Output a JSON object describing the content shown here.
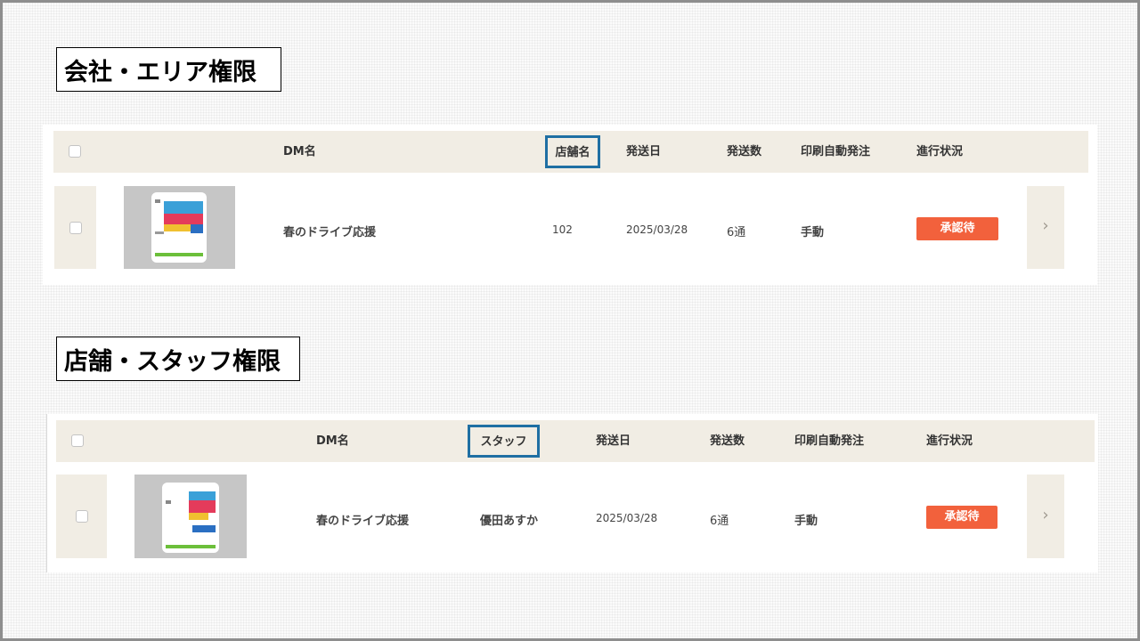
{
  "sections": [
    {
      "title": "会社・エリア権限",
      "headers": {
        "dm_name": "DM名",
        "store_name": "店舗名",
        "send_date": "発送日",
        "send_count": "発送数",
        "print_auto_order": "印刷自動発注",
        "progress": "進行状況"
      },
      "row": {
        "dm_name": "春のドライブ応援",
        "store": "102",
        "send_date": "2025/03/28",
        "send_count": "6通",
        "print_auto_order": "手動",
        "status": "承認待",
        "chevron": "›"
      }
    },
    {
      "title": "店舗・スタッフ権限",
      "headers": {
        "dm_name": "DM名",
        "staff": "スタッフ",
        "send_date": "発送日",
        "send_count": "発送数",
        "print_auto_order": "印刷自動発注",
        "progress": "進行状況"
      },
      "row": {
        "dm_name": "春のドライブ応援",
        "staff": "優田あすか",
        "send_date": "2025/03/28",
        "send_count": "6通",
        "print_auto_order": "手動",
        "status": "承認待",
        "chevron": "›"
      }
    }
  ],
  "colors": {
    "header_bg": "#f1ede4",
    "highlight_border": "#1f6fa3",
    "status_badge": "#f2613c"
  },
  "icons": [
    "checkbox-icon",
    "chevron-right-icon",
    "dm-thumbnail"
  ]
}
